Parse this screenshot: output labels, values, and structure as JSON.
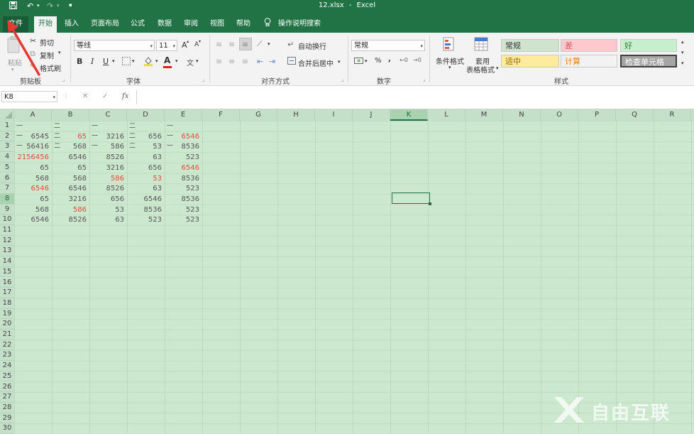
{
  "titlebar": {
    "save_icon": "save-icon",
    "undo_icon": "undo-icon",
    "redo_icon": "redo-icon",
    "file_name": "12.xlsx",
    "separator": "-",
    "app_name": "Excel"
  },
  "tabs": [
    "文件",
    "开始",
    "插入",
    "页面布局",
    "公式",
    "数据",
    "审阅",
    "视图",
    "帮助"
  ],
  "tell_me": "操作说明搜索",
  "clipboard": {
    "paste": "粘贴",
    "cut": "剪切",
    "copy": "复制",
    "format_painter": "格式刷",
    "group": "剪贴板"
  },
  "font": {
    "name": "等线",
    "size": "11",
    "bold": "B",
    "italic": "I",
    "underline": "U",
    "grow": "A",
    "shrink": "A",
    "color_a": "A",
    "wen": "文",
    "group": "字体"
  },
  "alignment": {
    "wrap": "自动换行",
    "merge": "合并后居中",
    "group": "对齐方式"
  },
  "number": {
    "format": "常规",
    "percent": "%",
    "comma": ",",
    "group": "数字"
  },
  "styles": {
    "conditional": "条件格式",
    "table_format_1": "套用",
    "table_format_2": "表格格式",
    "group": "样式",
    "cells": [
      {
        "label": "常规",
        "bg": "#cfe3cf",
        "fg": "#333333"
      },
      {
        "label": "差",
        "bg": "#ffc7ce",
        "fg": "#d35b5b"
      },
      {
        "label": "好",
        "bg": "#c6efce",
        "fg": "#3a7d3a"
      },
      {
        "label": "适中",
        "bg": "#ffeb9c",
        "fg": "#9c6500"
      },
      {
        "label": "计算",
        "bg": "#f2f2f2",
        "fg": "#fa7d00"
      },
      {
        "label": "检查单元格",
        "bg": "#a5a5a5",
        "fg": "#ffffff"
      }
    ]
  },
  "formula_bar": {
    "name_box": "K8",
    "cancel": "✕",
    "enter": "✓",
    "fx": "fx",
    "value": ""
  },
  "columns": [
    "A",
    "B",
    "C",
    "D",
    "E",
    "F",
    "G",
    "H",
    "I",
    "J",
    "K",
    "L",
    "M",
    "N",
    "O",
    "P",
    "Q",
    "R"
  ],
  "selected_column": "K",
  "selected_row": 8,
  "rows": [
    "1",
    "2",
    "3",
    "4",
    "5",
    "6",
    "7",
    "8",
    "9",
    "10",
    "11",
    "12",
    "13",
    "14",
    "15",
    "16",
    "17",
    "18",
    "19",
    "20",
    "21",
    "22",
    "23",
    "24",
    "25",
    "26",
    "27",
    "28",
    "29",
    "30"
  ],
  "header_row": [
    "一一一",
    "二二二",
    "一一一",
    "二二二",
    "一一一"
  ],
  "data": [
    [
      {
        "v": "6545"
      },
      {
        "v": "65",
        "red": true
      },
      {
        "v": "3216"
      },
      {
        "v": "656"
      },
      {
        "v": "6546",
        "red": true
      }
    ],
    [
      {
        "v": "56416"
      },
      {
        "v": "568"
      },
      {
        "v": "586"
      },
      {
        "v": "53"
      },
      {
        "v": "8536"
      }
    ],
    [
      {
        "v": "2156456",
        "red": true
      },
      {
        "v": "6546"
      },
      {
        "v": "8526"
      },
      {
        "v": "63"
      },
      {
        "v": "523"
      }
    ],
    [
      {
        "v": "65"
      },
      {
        "v": "65"
      },
      {
        "v": "3216"
      },
      {
        "v": "656"
      },
      {
        "v": "6546",
        "red": true
      }
    ],
    [
      {
        "v": "568"
      },
      {
        "v": "568"
      },
      {
        "v": "586",
        "red": true
      },
      {
        "v": "53",
        "red": true
      },
      {
        "v": "8536"
      }
    ],
    [
      {
        "v": "6546",
        "red": true
      },
      {
        "v": "6546"
      },
      {
        "v": "8526"
      },
      {
        "v": "63"
      },
      {
        "v": "523"
      }
    ],
    [
      {
        "v": "65"
      },
      {
        "v": "3216"
      },
      {
        "v": "656"
      },
      {
        "v": "6546"
      },
      {
        "v": "8536"
      }
    ],
    [
      {
        "v": "568"
      },
      {
        "v": "586",
        "red": true
      },
      {
        "v": "53"
      },
      {
        "v": "8536"
      },
      {
        "v": "523"
      }
    ],
    [
      {
        "v": "6546"
      },
      {
        "v": "8526"
      },
      {
        "v": "63"
      },
      {
        "v": "523"
      },
      {
        "v": "523"
      }
    ]
  ],
  "watermark": "自由互联",
  "colors": {
    "excel_green": "#217346",
    "grid_bg": "#cce8cf",
    "red_text": "#e24b3a",
    "arrow": "#e53935"
  }
}
